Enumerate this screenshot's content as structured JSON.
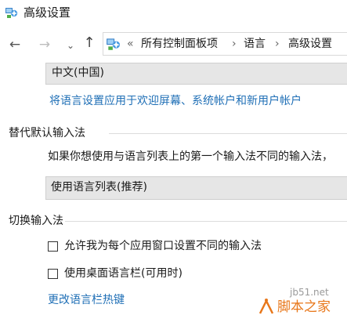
{
  "window": {
    "title": "高级设置"
  },
  "nav": {
    "back_glyph": "←",
    "forward_glyph": "→",
    "recent_glyph": "⌄",
    "up_glyph": "↑"
  },
  "address": {
    "chevrons": "«",
    "segments": [
      "所有控制面板项",
      "语言",
      "高级设置"
    ],
    "separator": "›"
  },
  "display_language": {
    "value": "中文(中国)"
  },
  "apply_link": "将语言设置应用于欢迎屏幕、系统帐户和新用户帐户",
  "override_input": {
    "heading": "替代默认输入法",
    "description": "如果你想使用与语言列表上的第一个输入法不同的输入法，",
    "selected": "使用语言列表(推荐)"
  },
  "switching": {
    "heading": "切换输入法",
    "options": [
      {
        "label": "允许我为每个应用窗口设置不同的输入法",
        "checked": false
      },
      {
        "label": "使用桌面语言栏(可用时)",
        "checked": false
      }
    ],
    "hotkey_link": "更改语言栏热键"
  },
  "watermark": {
    "site": "jb51.net",
    "text": "脚本之家"
  },
  "colors": {
    "link": "#1f6fb6",
    "dropdown_bg": "#e6e6e6",
    "watermark_orange": "#e8771a"
  }
}
